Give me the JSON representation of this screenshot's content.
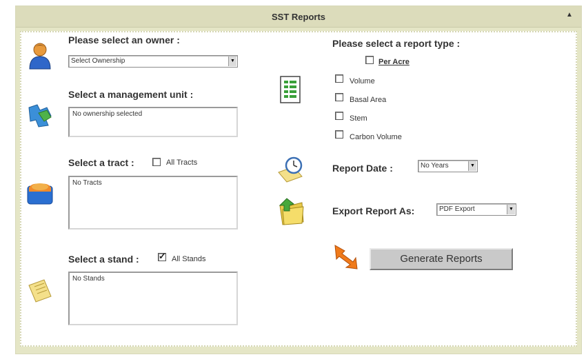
{
  "header": {
    "title": "SST Reports"
  },
  "owner": {
    "label": "Please select an owner :",
    "select_value": "Select Ownership"
  },
  "management_unit": {
    "label": "Select a management unit :",
    "list_text": "No ownership selected"
  },
  "tract": {
    "label": "Select a tract :",
    "all_label": "All Tracts",
    "all_checked": false,
    "list_text": "No Tracts"
  },
  "stand": {
    "label": "Select a stand :",
    "all_label": "All Stands",
    "all_checked": true,
    "list_text": "No Stands"
  },
  "report_type": {
    "label": "Please select a report type :",
    "per_acre_label": "Per Acre",
    "options": [
      {
        "label": "Volume",
        "checked": false
      },
      {
        "label": "Basal Area",
        "checked": false
      },
      {
        "label": "Stem",
        "checked": false
      },
      {
        "label": "Carbon Volume",
        "checked": false
      }
    ]
  },
  "report_date": {
    "label": "Report Date :",
    "select_value": "No Years"
  },
  "export": {
    "label": "Export Report As:",
    "select_value": "PDF Export"
  },
  "generate_button": {
    "label": "Generate Reports"
  },
  "icons": {
    "owner": "user-icon",
    "management_unit": "puzzle-icon",
    "tract": "folder-map-icon",
    "stand": "note-icon",
    "report_type": "document-list-icon",
    "report_date": "clock-icon",
    "export": "export-folder-icon",
    "generate": "arrow-icon"
  }
}
